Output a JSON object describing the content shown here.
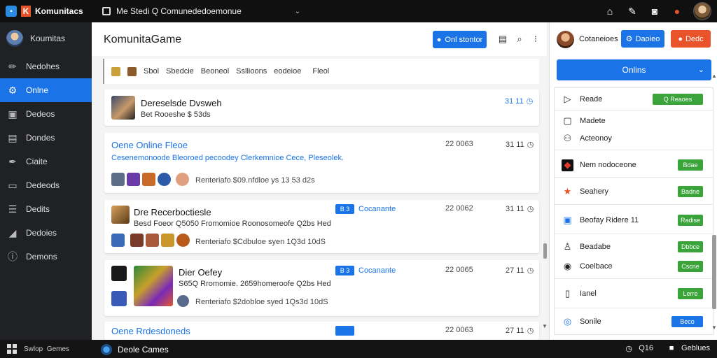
{
  "topbar": {
    "app_name": "Komunitacs",
    "window_title": "Me Stedi Q Comunededoemonue",
    "logo_letter": "K",
    "icons": [
      "home-icon",
      "tools-icon",
      "controller-icon",
      "settings-icon"
    ]
  },
  "sidebar": {
    "items": [
      {
        "label": "Koumitas",
        "icon": "avatar"
      },
      {
        "label": "Nedohes",
        "icon": "pencil-icon"
      },
      {
        "label": "Onlne",
        "icon": "gear-icon",
        "active": true
      },
      {
        "label": "Dedeos",
        "icon": "video-icon"
      },
      {
        "label": "Dondes",
        "icon": "chat-icon"
      },
      {
        "label": "Ciaite",
        "icon": "pen-icon"
      },
      {
        "label": "Dedeods",
        "icon": "screen-icon"
      },
      {
        "label": "Dedits",
        "icon": "list-icon"
      },
      {
        "label": "Dedoies",
        "icon": "chart-icon"
      },
      {
        "label": "Demons",
        "icon": "info-icon"
      }
    ]
  },
  "main": {
    "title": "KomunitaGame",
    "new_button": "Onl stontor",
    "filters": [
      "Sbol",
      "Sbedcie",
      "Beoneol",
      "Ssllioons",
      "eodeioe",
      "Fleol"
    ],
    "cards": [
      {
        "title": "Dereselsde Dvsweh",
        "subtitle": "Bet Rooeshe $ 53ds",
        "clock": "31 11",
        "date": ""
      },
      {
        "title": "Oene Online Fleoe",
        "subtitle": "Cesenemonoode Bleoroed pecoodey Clerkemnioe Cece, Pleseolek.",
        "meta": "Renteriafo $09.nfdloe ys 13 53 d2s",
        "date": "22 0063",
        "clock": "31 11"
      },
      {
        "title": "Dre Recerboctiesle",
        "subtitle": "Besd Foeor Q5050 Fromomioe Roonosomeofe Q2bs Hed",
        "meta": "Renteriafo $Cdbuloe syen 1Q3d 10dS",
        "tag": "Cocanante",
        "tag_box": "B 3",
        "date": "22 0062",
        "clock": "31 11"
      },
      {
        "title": "Dier Oefey",
        "subtitle": "S65Q Rromomie. 2659homeroofe Q2bs Hed",
        "meta": "Renteriafo $2dobloe syed 1Qs3d 10dS",
        "tag": "Cocanante",
        "tag_box": "B 3",
        "date": "22 0065",
        "clock": "27 11"
      },
      {
        "title": "Oene Rrdesdoneds",
        "subtitle": "",
        "meta": "",
        "tag": "",
        "tag_box": "",
        "date": "22 0063",
        "clock": "27 11"
      }
    ]
  },
  "right_panel": {
    "user_name": "Cotaneioes",
    "primary_button": "Daoieo",
    "secondary_button": "Dedc",
    "select_value": "Onlins",
    "rows": [
      {
        "label": "Reade",
        "badge": "Q Reaoes",
        "badge_color": "#3aa33a",
        "icon": "play-icon"
      },
      {
        "label": "Madete",
        "badge": "",
        "icon": "square-icon"
      },
      {
        "label": "Acteonoy",
        "badge": "",
        "icon": "group-icon"
      },
      {
        "label": "Nem nodoceone",
        "badge": "Bdae",
        "badge_color": "#3aa33a",
        "icon": "flag-icon"
      },
      {
        "label": "Seahery",
        "badge": "Badne",
        "badge_color": "#3aa33a",
        "icon": "star-icon"
      },
      {
        "label": "Beofay Ridere 11",
        "badge": "Radise",
        "badge_color": "#3aa33a",
        "icon": "tile-icon"
      },
      {
        "label": "Beadabe",
        "badge": "Dbbce",
        "badge_color": "#3aa33a",
        "icon": "user-icon"
      },
      {
        "label": "Coelbace",
        "badge": "Cscne",
        "badge_color": "#3aa33a",
        "icon": "circle-icon"
      },
      {
        "label": "Ianel",
        "badge": "Lerre",
        "badge_color": "#3aa33a",
        "icon": "doc-icon"
      },
      {
        "label": "Sonile",
        "badge": "Beco",
        "badge_color": "#1b73e8",
        "icon": "ring-icon"
      }
    ]
  },
  "bottombar": {
    "left_label": "Swlop  Gemes",
    "game_label": "Deole Cames",
    "count": "Q16",
    "right_label": "Geblues"
  }
}
